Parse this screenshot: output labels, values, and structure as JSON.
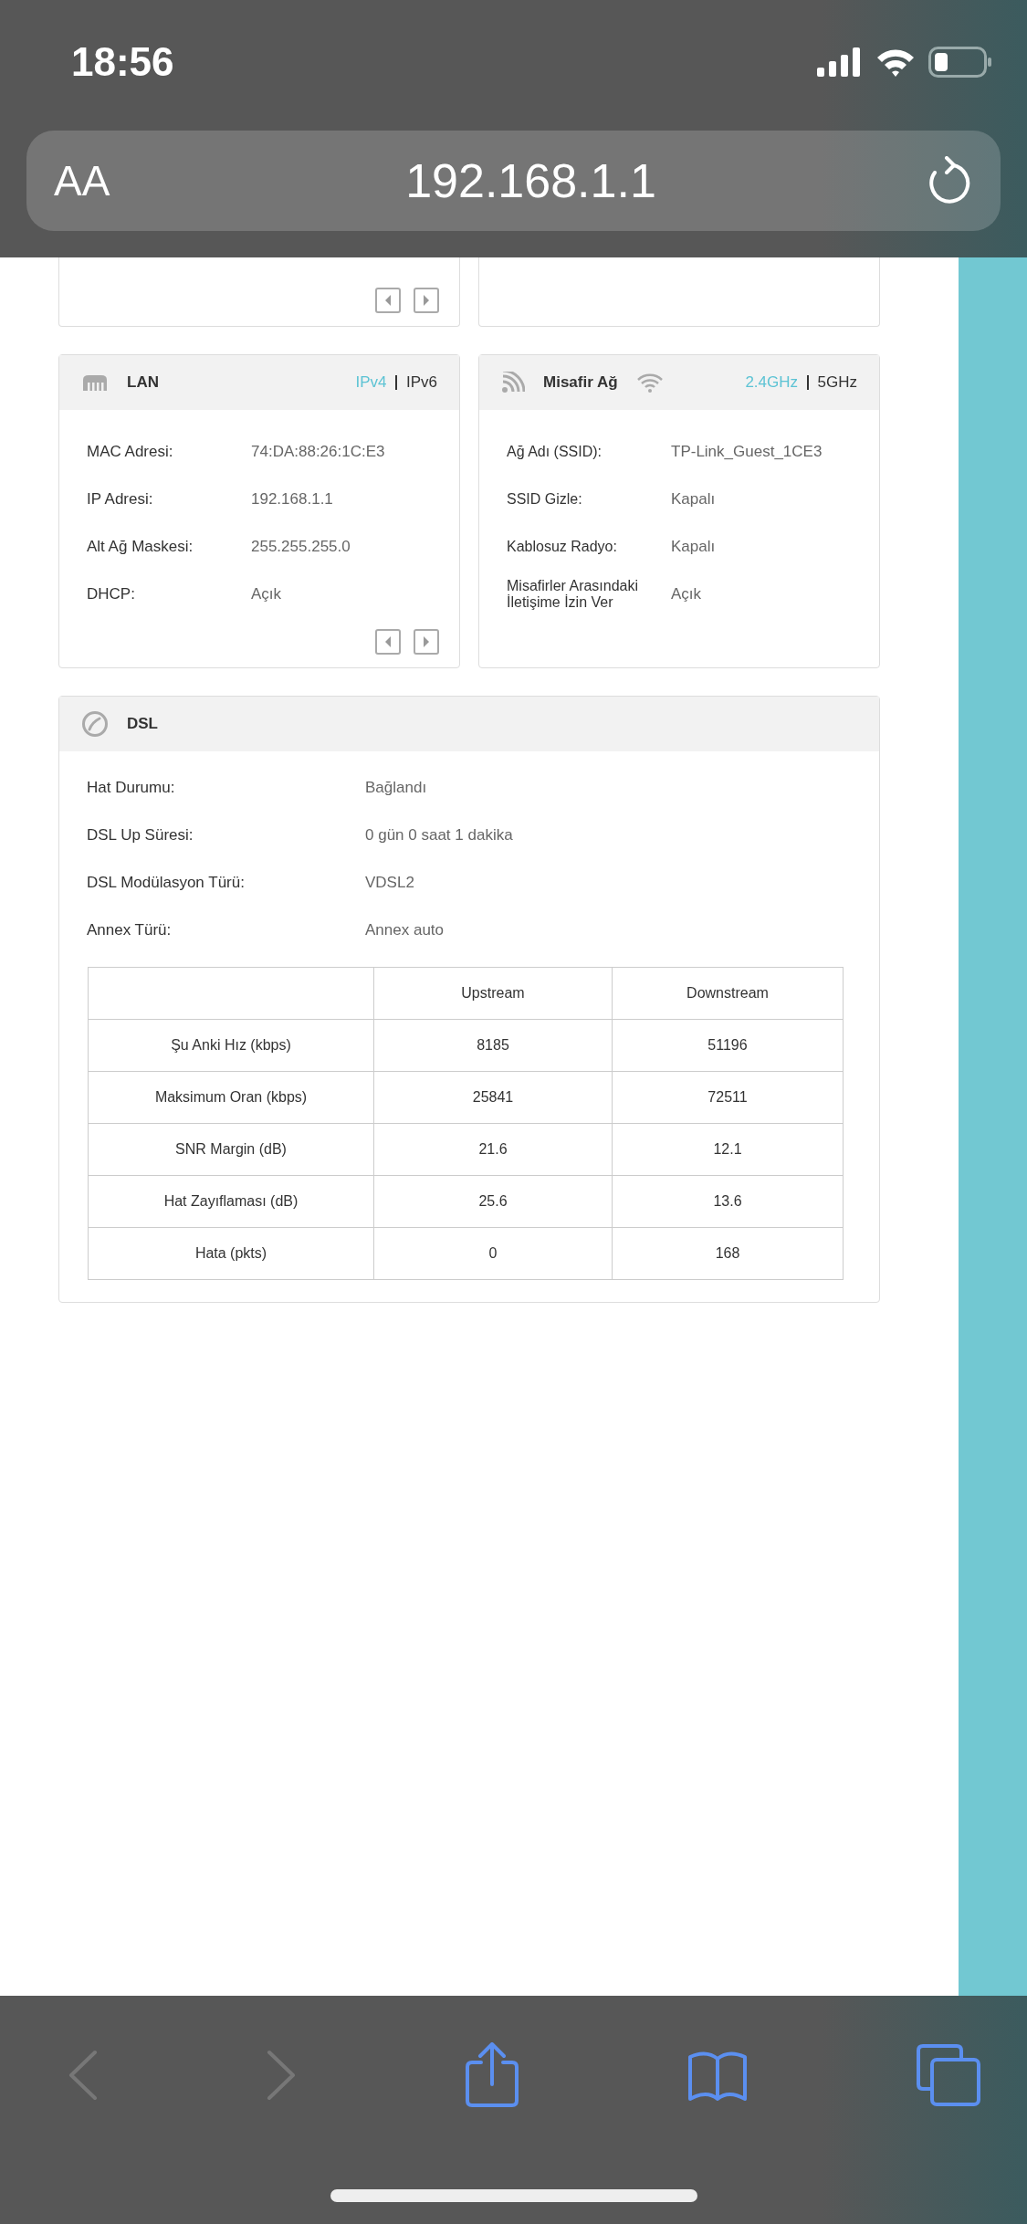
{
  "status_bar": {
    "time": "18:56"
  },
  "address_bar": {
    "text_size_button": "AA",
    "url": "192.168.1.1"
  },
  "lan": {
    "title": "LAN",
    "tabs": [
      {
        "label": "IPv4",
        "selected": true
      },
      {
        "label": "IPv6",
        "selected": false
      }
    ],
    "rows": [
      {
        "label": "MAC Adresi:",
        "value": "74:DA:88:26:1C:E3"
      },
      {
        "label": "IP Adresi:",
        "value": "192.168.1.1"
      },
      {
        "label": "Alt Ağ Maskesi:",
        "value": "255.255.255.0"
      },
      {
        "label": "DHCP:",
        "value": "Açık"
      }
    ]
  },
  "guest_network": {
    "title": "Misafir Ağ",
    "tabs": [
      {
        "label": "2.4GHz",
        "selected": true
      },
      {
        "label": "5GHz",
        "selected": false
      }
    ],
    "rows": [
      {
        "label": "Ağ Adı (SSID):",
        "value": "TP-Link_Guest_1CE3"
      },
      {
        "label": "SSID Gizle:",
        "value": "Kapalı"
      },
      {
        "label": "Kablosuz Radyo:",
        "value": "Kapalı"
      },
      {
        "label": "Misafirler Arasındaki İletişime İzin Ver",
        "value": "Açık"
      }
    ]
  },
  "dsl": {
    "title": "DSL",
    "rows": [
      {
        "label": "Hat Durumu:",
        "value": "Bağlandı"
      },
      {
        "label": "DSL Up Süresi:",
        "value": "0 gün 0 saat 1 dakika"
      },
      {
        "label": "DSL Modülasyon Türü:",
        "value": "VDSL2"
      },
      {
        "label": "Annex Türü:",
        "value": "Annex auto"
      }
    ],
    "table": {
      "columns": [
        "",
        "Upstream",
        "Downstream"
      ],
      "rows": [
        [
          "Şu Anki Hız (kbps)",
          "8185",
          "51196"
        ],
        [
          "Maksimum Oran (kbps)",
          "25841",
          "72511"
        ],
        [
          "SNR Margin (dB)",
          "21.6",
          "12.1"
        ],
        [
          "Hat Zayıflaması (dB)",
          "25.6",
          "13.6"
        ],
        [
          "Hata (pkts)",
          "0",
          "168"
        ]
      ]
    }
  },
  "toolbar": {
    "back_disabled": true,
    "forward_disabled": true
  }
}
